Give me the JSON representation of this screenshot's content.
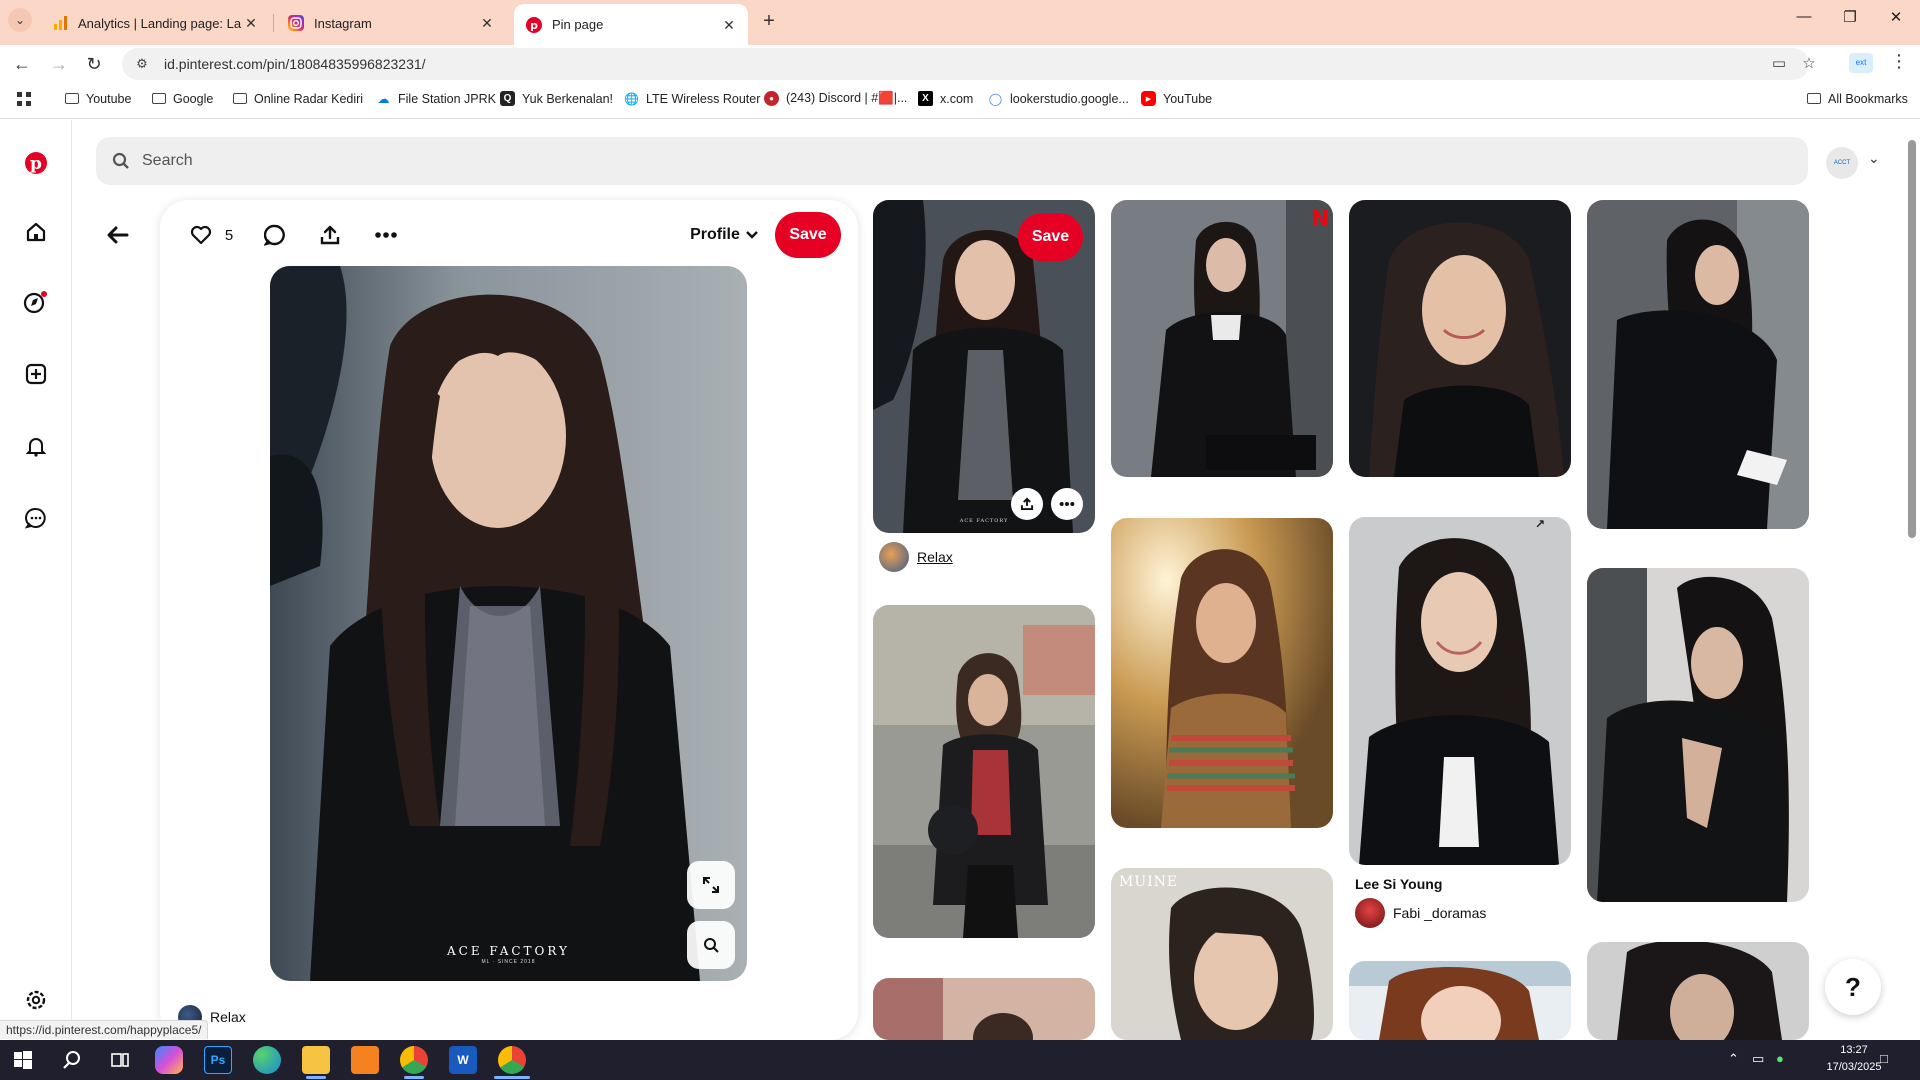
{
  "browser": {
    "tabs": [
      {
        "title": "Analytics | Landing page: Landi",
        "active": false,
        "icon": "analytics-icon"
      },
      {
        "title": "Instagram",
        "active": false,
        "icon": "instagram-icon"
      },
      {
        "title": "Pin page",
        "active": true,
        "icon": "pinterest-icon"
      }
    ],
    "url": "id.pinterest.com/pin/18084835996823231/",
    "bookmarks": [
      {
        "label": "Youtube",
        "icon": "folder-icon"
      },
      {
        "label": "Google",
        "icon": "folder-icon"
      },
      {
        "label": "Online Radar Kediri",
        "icon": "folder-icon"
      },
      {
        "label": "File Station JPRK",
        "icon": "file-station-icon"
      },
      {
        "label": "Yuk Berkenalan!",
        "icon": "quora-icon"
      },
      {
        "label": "LTE Wireless Router",
        "icon": "globe-icon"
      },
      {
        "label": "(243) Discord | #🟥|...",
        "icon": "discord-icon"
      },
      {
        "label": "x.com",
        "icon": "x-icon"
      },
      {
        "label": "lookerstudio.google...",
        "icon": "lookerstudio-icon"
      },
      {
        "label": "YouTube",
        "icon": "youtube-icon"
      }
    ],
    "all_bookmarks": "All Bookmarks",
    "status_url": "https://id.pinterest.com/happyplace5/"
  },
  "pinterest": {
    "search_placeholder": "Search",
    "closeup": {
      "like_count": "5",
      "profile_label": "Profile",
      "save_label": "Save",
      "image_watermark": "ACE FACTORY",
      "image_watermark_sub": "ML · SINCE 2018",
      "author": "Relax"
    },
    "grid": {
      "save_label": "Save",
      "pin1_author": "Relax",
      "pin_title_lee": "Lee Si Young",
      "pin_author_fabi": "Fabi _doramas",
      "muine_text": "MUINE",
      "pin1_watermark": "ACE FACTORY"
    },
    "help": "?"
  },
  "taskbar": {
    "time": "13:27",
    "date": "17/03/2025"
  },
  "colors": {
    "pinterest_red": "#e60023",
    "tabstrip": "#fbd7c7"
  }
}
